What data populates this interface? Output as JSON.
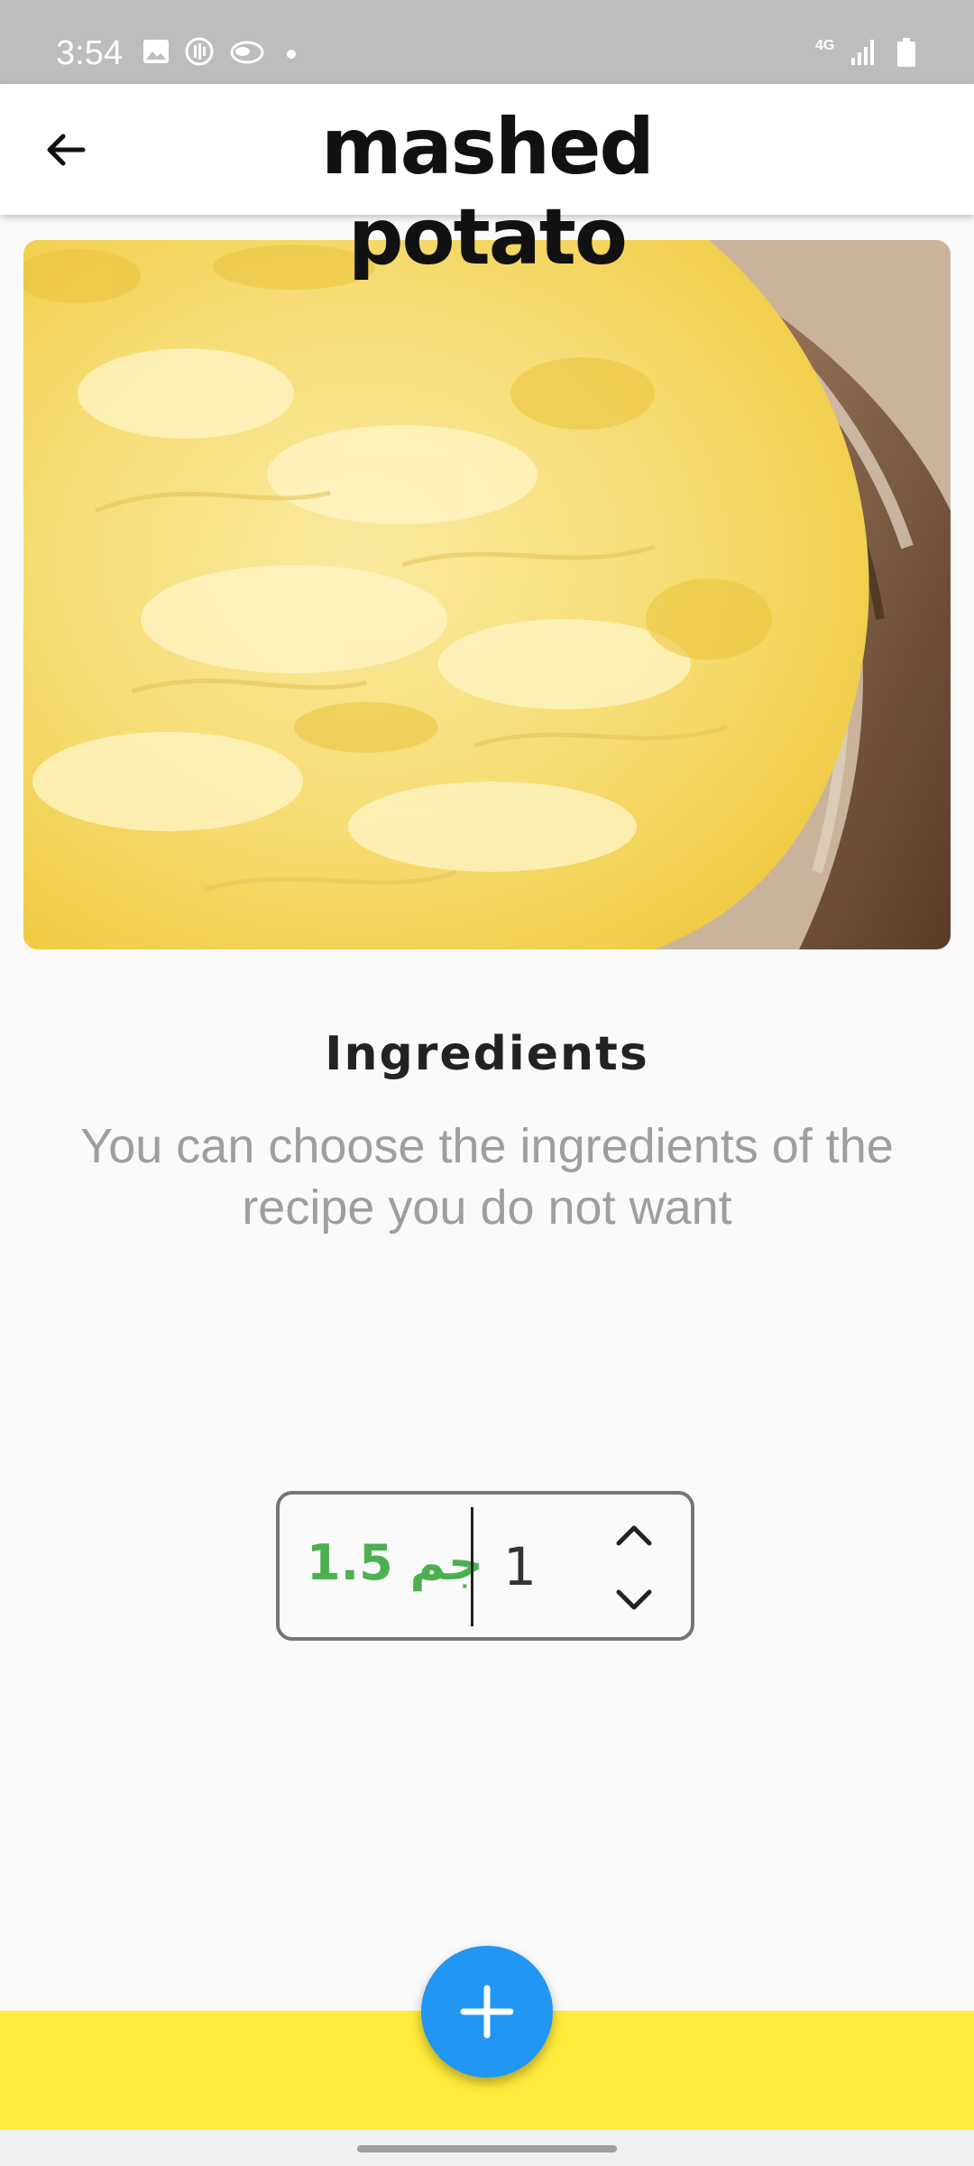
{
  "status_bar": {
    "time": "3:54",
    "network": "4G",
    "icons": [
      "image-icon",
      "podcast-icon",
      "cloud-icon",
      "signal-icon",
      "battery-icon"
    ]
  },
  "header": {
    "title": "mashed potato",
    "back_icon": "back-arrow-icon"
  },
  "hero": {
    "subject": "photo of mashed potato in decorative bowl"
  },
  "ingredients": {
    "heading": "Ingredients",
    "description": "You can choose the ingredients of the recipe you do not want"
  },
  "stepper": {
    "price": "1.5 ﺟﻢ",
    "quantity": "1",
    "increment_icon": "chevron-up-icon",
    "decrement_icon": "chevron-down-icon"
  },
  "fab": {
    "icon": "plus-icon"
  },
  "colors": {
    "status_bar": "#bdbdbd",
    "accent_green": "#4caf50",
    "fab_blue": "#2196f3",
    "bottom_bar_yellow": "#ffeb3b"
  }
}
